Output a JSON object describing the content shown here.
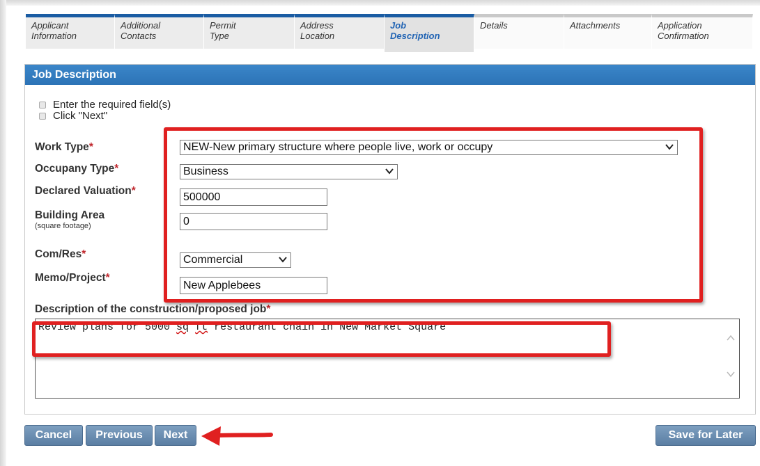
{
  "tabs": [
    {
      "line1": "Applicant",
      "line2": "Information",
      "state": "done"
    },
    {
      "line1": "Additional",
      "line2": "Contacts",
      "state": "done"
    },
    {
      "line1": "Permit",
      "line2": "Type",
      "state": "done"
    },
    {
      "line1": "Address",
      "line2": "Location",
      "state": "done"
    },
    {
      "line1": "Job",
      "line2": "Description",
      "state": "active"
    },
    {
      "line1": "Details",
      "line2": "",
      "state": "future"
    },
    {
      "line1": "Attachments",
      "line2": "",
      "state": "future"
    },
    {
      "line1": "Application",
      "line2": "Confirmation",
      "state": "future"
    }
  ],
  "panel": {
    "title": "Job Description"
  },
  "instructions": [
    "Enter the required field(s)",
    "Click \"Next\""
  ],
  "fields": {
    "work_type": {
      "label": "Work Type",
      "value": "NEW-New primary structure where people live, work or occupy"
    },
    "occupancy_type": {
      "label": "Occupany Type",
      "value": "Business"
    },
    "declared_valuation": {
      "label": "Declared Valuation",
      "value": "500000"
    },
    "building_area": {
      "label": "Building Area",
      "sub": "(square footage)",
      "value": "0"
    },
    "com_res": {
      "label": "Com/Res",
      "value": "Commercial"
    },
    "memo_project": {
      "label": "Memo/Project",
      "value": "New Applebees"
    },
    "description": {
      "label": "Description of the construction/proposed job",
      "value_pre": "Review plans for 5000 ",
      "value_sq": "sq",
      "value_ft": "ft",
      "value_post": " restaurant chain in New Market Square"
    }
  },
  "required_marker": "*",
  "buttons": {
    "cancel": "Cancel",
    "previous": "Previous",
    "next": "Next",
    "save_later": "Save for Later"
  },
  "colors": {
    "accent": "#2c73b6",
    "highlight": "#e02020",
    "button": "#6a8db2"
  }
}
